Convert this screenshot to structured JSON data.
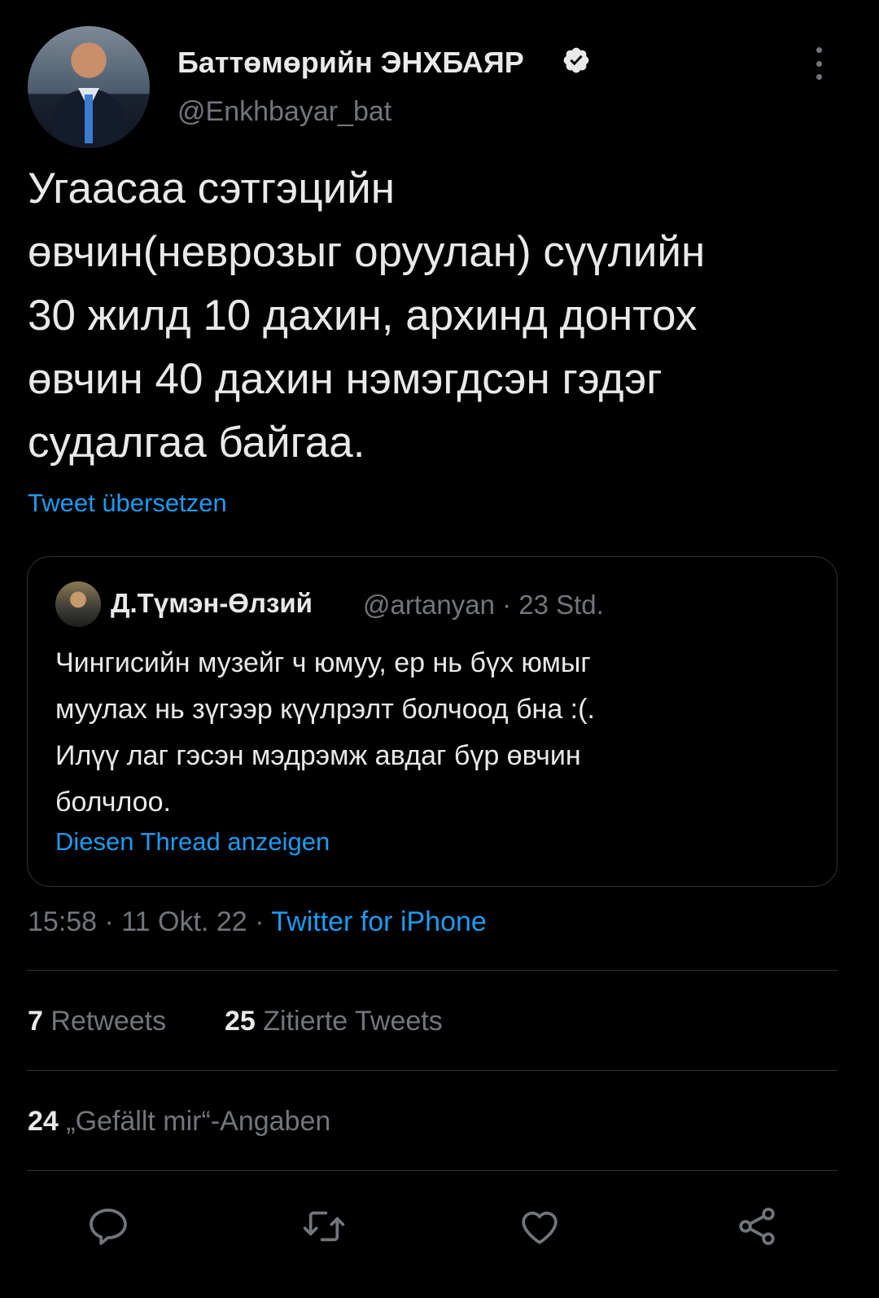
{
  "author": {
    "name": "Баттөмөрийн ЭНХБАЯР",
    "handle": "@Enkhbayar_bat"
  },
  "tweet": {
    "lines": [
      "Угаасаа сэтгэцийн",
      "өвчин(неврозыг оруулан) сүүлийн",
      "30 жилд 10 дахин, архинд донтох",
      "өвчин 40 дахин нэмэгдсэн гэдэг",
      "судалгаа байгаа."
    ],
    "translate_label": "Tweet übersetzen"
  },
  "quoted": {
    "name": "Д.Түмэн-Өлзий",
    "handle_time": "@artanyan · 23 Std.",
    "lines": [
      "Чингисийн музейг ч юмуу, ер нь бүх юмыг",
      "муулах нь зүгээр күүлрэлт болчоод бна :(.",
      "Илүү лаг гэсэн мэдрэмж авдаг бүр өвчин",
      "болчлоо."
    ],
    "thread_label": "Diesen Thread anzeigen"
  },
  "meta": {
    "time_date": "15:58 · 11 Okt. 22 · ",
    "source": "Twitter for iPhone"
  },
  "stats": {
    "retweets_count": "7",
    "retweets_label": " Retweets",
    "quotes_count": "25",
    "quotes_label": " Zitierte Tweets",
    "likes_count": "24",
    "likes_label": " „Gefällt mir“-Angaben"
  },
  "colors": {
    "background": "#000000",
    "text": "#e7e9ea",
    "secondary": "#71767b",
    "accent": "#1d9bf0",
    "divider": "#2f3336"
  },
  "icons": [
    "verified-badge-icon",
    "more-options-icon",
    "reply-icon",
    "retweet-icon",
    "like-icon",
    "share-icon"
  ]
}
